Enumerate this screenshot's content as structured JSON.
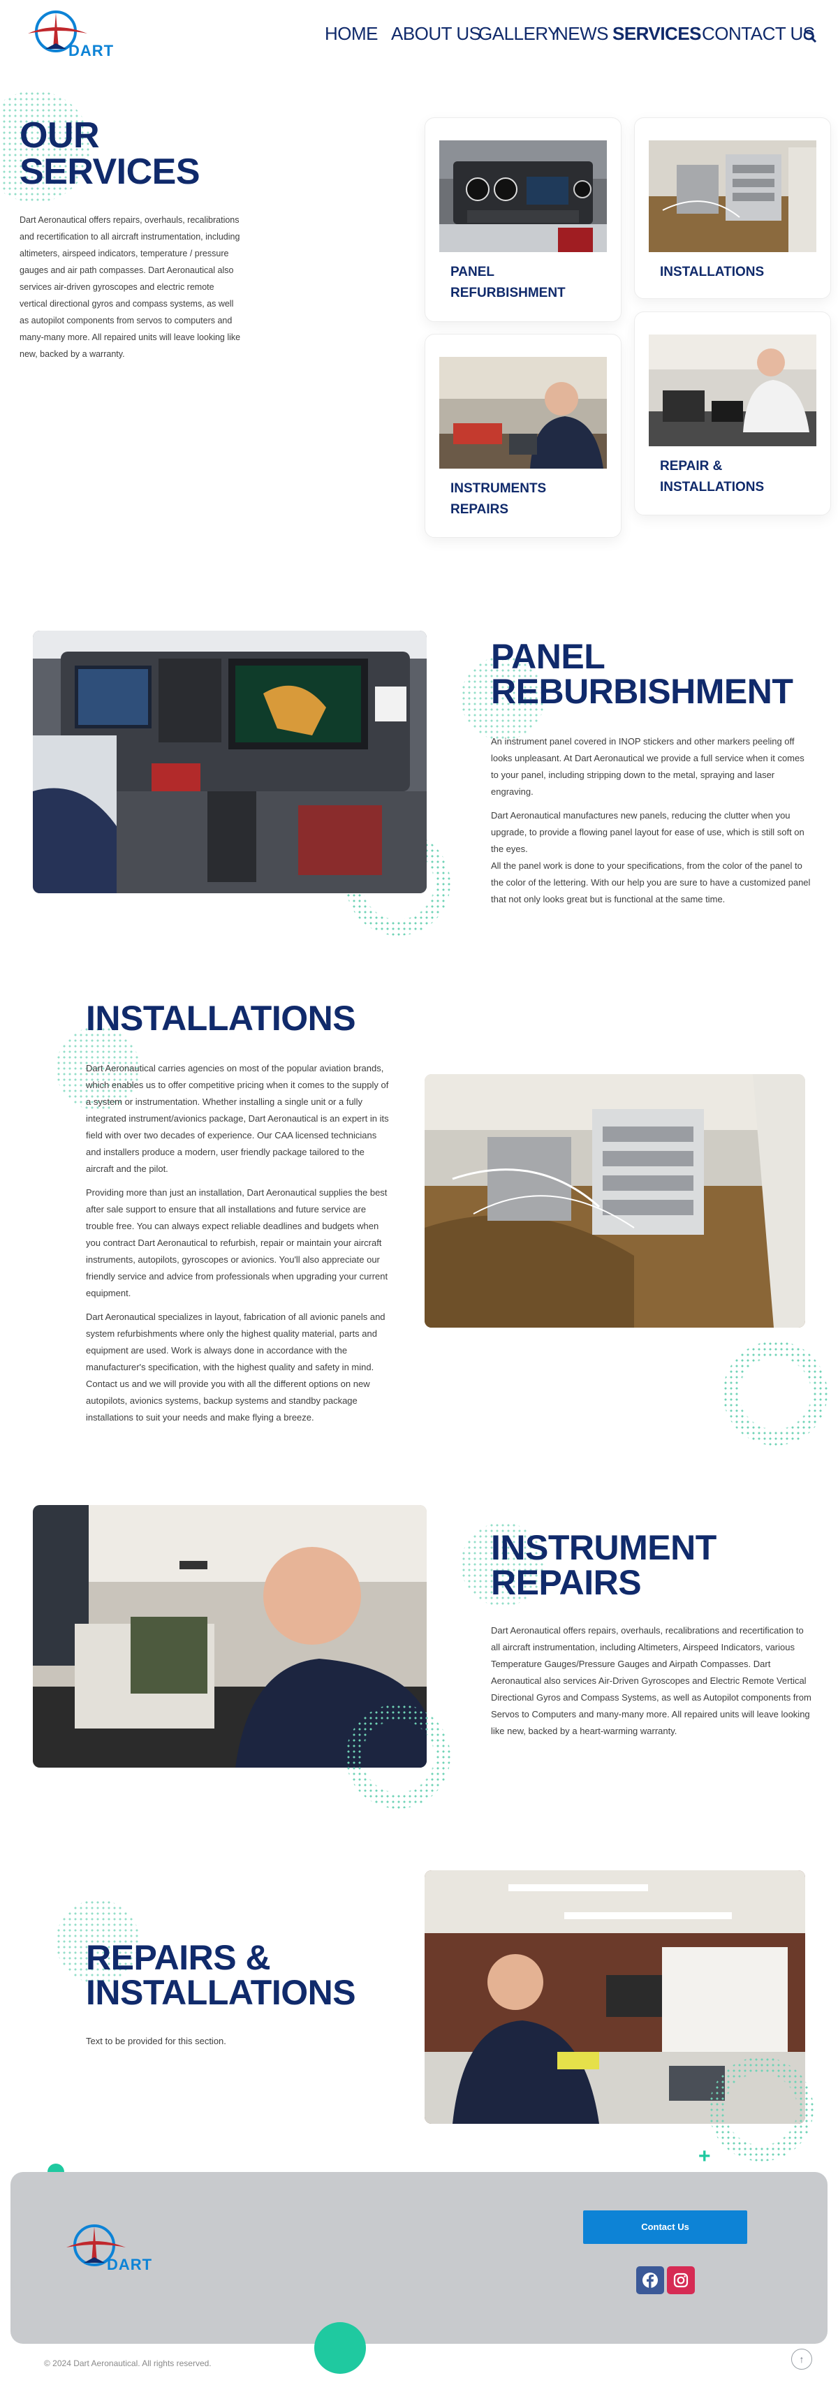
{
  "brand": {
    "name": "DART"
  },
  "nav": {
    "items": [
      "HOME",
      "ABOUT US",
      "GALLERY",
      "NEWS",
      "SERVICES",
      "CONTACT US"
    ],
    "active": "SERVICES"
  },
  "hero": {
    "title_line1": "OUR",
    "title_line2": "SERVICES",
    "text": "Dart Aeronautical offers repairs, overhauls, recalibrations and recertification to all aircraft instrumentation, including altimeters, airspeed indicators, temperature / pressure gauges and air path compasses. Dart Aeronautical also services air-driven gyroscopes and electric remote vertical directional gyros and compass systems, as well as autopilot components from servos to computers and many-many more. All repaired units will leave looking like new, backed by a warranty.",
    "cards": [
      {
        "line1": "PANEL",
        "line2": "REFURBISHMENT"
      },
      {
        "line1": "INSTALLATIONS",
        "line2": ""
      },
      {
        "line1": "INSTRUMENTS",
        "line2": "REPAIRS"
      },
      {
        "line1": "REPAIR &",
        "line2": "INSTALLATIONS"
      }
    ]
  },
  "panel": {
    "title_line1": "PANEL",
    "title_line2": "REBURBISHMENT",
    "p1": "An instrument panel covered in INOP stickers and other markers peeling off looks unpleasant. At Dart Aeronautical we provide a full service when it comes to your panel, including stripping down to the metal, spraying and laser engraving.",
    "p2": "Dart Aeronautical manufactures new panels, reducing the clutter when you upgrade, to provide a flowing panel layout for ease of use, which is still soft on the eyes.",
    "p3": "All the panel work is done to your specifications, from the color of the panel to the color of the lettering. With our help you are sure to have a customized panel that not only looks great but is functional at the same time."
  },
  "installations": {
    "title": "INSTALLATIONS",
    "p1": "Dart Aeronautical carries agencies on most of the popular aviation brands, which enables us to offer competitive pricing when it comes to the supply of a system or instrumentation. Whether installing a single unit or a fully integrated instrument/avionics package, Dart Aeronautical is an expert in its field with over two decades of experience. Our CAA licensed technicians and installers produce a modern, user friendly package tailored to the aircraft and the pilot.",
    "p2": "Providing more than just an installation, Dart Aeronautical supplies the best after sale support to ensure that all installations and future service are trouble free. You can always expect reliable deadlines and budgets when you contract Dart Aeronautical to refurbish, repair or maintain your aircraft instruments, autopilots, gyroscopes or avionics. You'll also appreciate our friendly service and advice from professionals when upgrading your current equipment.",
    "p3": "Dart Aeronautical specializes in layout, fabrication of all avionic panels and system refurbishments where only the highest quality material, parts and equipment are used. Work is always done in accordance with the manufacturer's specification, with the highest quality and safety in mind. Contact us and we will provide you with all the different options on new autopilots, avionics systems, backup systems and standby package installations to suit your needs and make flying a breeze."
  },
  "instrument": {
    "title_line1": "INSTRUMENT",
    "title_line2": "REPAIRS",
    "p1": "Dart Aeronautical offers repairs, overhauls, recalibrations and recertification to all aircraft instrumentation, including Altimeters, Airspeed Indicators, various Temperature Gauges/Pressure Gauges and Airpath Compasses. Dart Aeronautical also services Air-Driven Gyroscopes and Electric Remote Vertical Directional Gyros and Compass Systems, as well as Autopilot components from Servos to Computers and many-many more. All repaired units will leave looking like new, backed by a heart-warming warranty."
  },
  "repairs": {
    "title_line1": "REPAIRS &",
    "title_line2": "INSTALLATIONS",
    "p1": "Text to be provided for this section."
  },
  "footer": {
    "contact_button": "Contact Us",
    "copyright": "© 2024 Dart Aeronautical. All rights reserved."
  },
  "colors": {
    "navy": "#102a6b",
    "accent_blue": "#0d83d6",
    "mint": "#1fc9a0",
    "footer_bg": "#c8cacd"
  }
}
